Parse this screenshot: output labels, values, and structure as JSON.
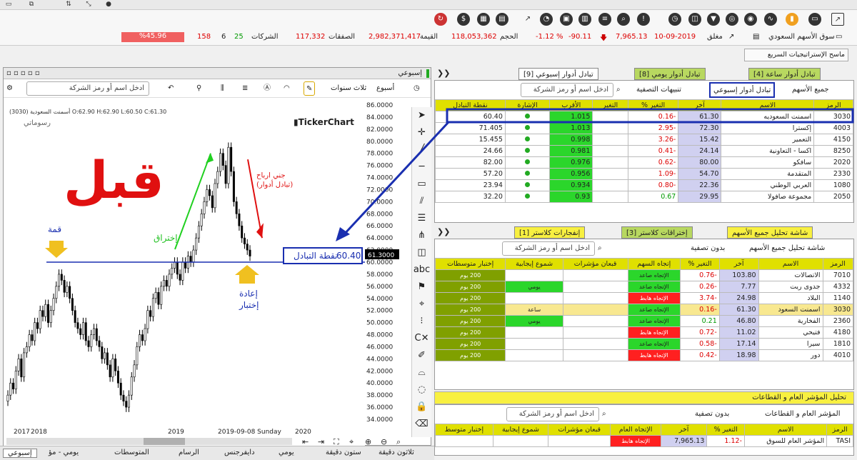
{
  "window": {
    "buttons": [
      "▭",
      "⧉",
      "⇅",
      "⤡",
      "●"
    ],
    "strategy_btn": "ماسح الإستراتيجيات السريع"
  },
  "market": {
    "name": "سوق الأسهم السعودي",
    "status": "مغلق",
    "date": "10-09-2019",
    "index": "7,965.13",
    "change": "-90.11",
    "change_pct": "-1.12 %",
    "volume_label": "الحجم",
    "volume": "118,053,362",
    "value_label": "القيمة",
    "value": "2,982,371,417",
    "trades_label": "الصفقات",
    "trades": "117,332",
    "companies_label": "الشركات",
    "up": "25",
    "flat": "6",
    "down": "158",
    "breadth": "%45.96"
  },
  "chart": {
    "title": "إسبوعي",
    "period": "أسبوع",
    "range": "ثلاث سنوات",
    "search": "ادخل اسم أو رمز الشركة",
    "ohlc": "(3030) أسمنت السعودية O:62.90 H:62.90 L:60.50 C:61.30",
    "watermark": "TickerChart",
    "drawings_label": "رسوماتي",
    "before": "قبل",
    "peak": "قمة",
    "breakout": "إختراق",
    "take_profit": "جني ارباح\n(تبادل أدوار)",
    "retest": "إعادة\nإختبار",
    "trading_point_label": "نقطة التبادل",
    "trading_point_val": "60.40",
    "price_tag": "61.3000",
    "x_labels": [
      "2017",
      "2018",
      "2019",
      "2019-09-08 Sunday",
      "2020"
    ],
    "y_labels": [
      "86.0000",
      "84.0000",
      "82.0000",
      "80.0000",
      "78.0000",
      "76.0000",
      "74.0000",
      "72.0000",
      "70.0000",
      "68.0000",
      "66.0000",
      "64.0000",
      "62.0000",
      "60.0000",
      "58.0000",
      "56.0000",
      "54.0000",
      "52.0000",
      "50.0000",
      "48.0000",
      "46.0000",
      "44.0000",
      "42.0000",
      "40.0000",
      "38.0000",
      "36.0000",
      "34.0000"
    ]
  },
  "bottom_tabs": [
    "إسبوعي",
    "يومي - مؤ",
    "المتوسطات",
    "الرسام",
    "دايفرجنس",
    "يومي",
    "ستون دقيقة",
    "ثلاثون دقيقة"
  ],
  "top_tabs": [
    "تبادل أدوار ساعة [4]",
    "تبادل أدوار يومي [8]",
    "تبادل أدوار إسبوعي [9]"
  ],
  "rotation": {
    "all": "جميع الأسهم",
    "filter": "تبادل أدوار إسبوعي",
    "alerts": "تنبيهات التصفية",
    "search": "ادخل اسم أو رمز الشركة",
    "cols": [
      "الرمز",
      "الاسم",
      "آخر",
      "التغير %",
      "التغير",
      "الأقرب",
      "الإشارة",
      "نقطة التبادل"
    ],
    "rows": [
      [
        "3030",
        "اسمنت السعوديه",
        "61.30",
        "-0.16",
        "",
        "1.015",
        "",
        "60.40"
      ],
      [
        "4003",
        "إكسترا",
        "72.30",
        "-2.95",
        "",
        "1.013",
        "",
        "71.405"
      ],
      [
        "4150",
        "التعمير",
        "15.42",
        "-3.26",
        "",
        "0.998",
        "",
        "15.455"
      ],
      [
        "8250",
        "اكسا - التعاونية",
        "24.14",
        "-0.41",
        "",
        "0.981",
        "",
        "24.66"
      ],
      [
        "2020",
        "سافكو",
        "80.00",
        "-0.62",
        "",
        "0.976",
        "",
        "82.00"
      ],
      [
        "2330",
        "المتقدمة",
        "54.70",
        "-1.09",
        "",
        "0.956",
        "",
        "57.20"
      ],
      [
        "1080",
        "العربي الوطني",
        "22.36",
        "-0.80",
        "",
        "0.934",
        "",
        "23.94"
      ],
      [
        "2050",
        "مجموعة صافولا",
        "29.95",
        "0.67",
        "",
        "0.93",
        "",
        "32.20"
      ]
    ]
  },
  "mid_tabs": [
    "شاشة تحليل جميع الأسهم",
    "إختراقات كلاستر [3]",
    "إنفجارات كلاستر [1]"
  ],
  "analysis": {
    "title": "شاشة تحليل جميع الأسهم",
    "filter": "بدون تصفية",
    "search": "ادخل اسم أو رمز الشركة",
    "cols": [
      "الرمز",
      "الاسم",
      "آخر",
      "التغير %",
      "إتجاه السهم",
      "قبعان مؤشرات",
      "شموع إيجابية",
      "إختبار متوسطات"
    ],
    "rows": [
      [
        "7010",
        "الاتصالات",
        "103.80",
        "-0.76",
        "الإتجاه صاعد",
        "",
        "",
        "200 يوم"
      ],
      [
        "4332",
        "جدوى ريت",
        "7.77",
        "-0.26",
        "الإتجاه صاعد",
        "",
        "يومي",
        "200 يوم"
      ],
      [
        "1140",
        "البلاد",
        "24.98",
        "-3.74",
        "الإتجاه هابط",
        "",
        "",
        "200 يوم"
      ],
      [
        "3030",
        "اسمنت السعود",
        "61.30",
        "-0.16",
        "الإتجاه صاعد",
        "",
        "ساعة",
        "200 يوم"
      ],
      [
        "2360",
        "الفخارية",
        "46.80",
        "0.21",
        "الإتجاه صاعد",
        "",
        "يومي",
        "200 يوم"
      ],
      [
        "4180",
        "فتيحي",
        "11.02",
        "-0.72",
        "الإتجاه هابط",
        "",
        "",
        "200 يوم"
      ],
      [
        "1810",
        "سيرا",
        "17.14",
        "-0.58",
        "الإتجاه صاعد",
        "",
        "",
        "200 يوم"
      ],
      [
        "4010",
        "دور",
        "18.98",
        "-0.42",
        "الإتجاه هابط",
        "",
        "",
        "200 يوم"
      ]
    ]
  },
  "index_panel": {
    "tab": "تحليل المؤشر العام و القطاعات",
    "title": "المؤشر العام و القطاعات",
    "filter": "بدون تصفية",
    "search": "ادخل اسم أو رمز الشركة",
    "cols": [
      "الرمز",
      "الاسم",
      "التغير %",
      "آخر",
      "الإتجاه العام",
      "قبعان مؤشرات",
      "شموع إيجابية",
      "إختبار متوسط"
    ],
    "row": [
      "TASI",
      "المؤشر العام للسوق",
      "-1.12",
      "7,965.13",
      "الإتجاه هابط",
      "",
      "",
      ""
    ]
  }
}
